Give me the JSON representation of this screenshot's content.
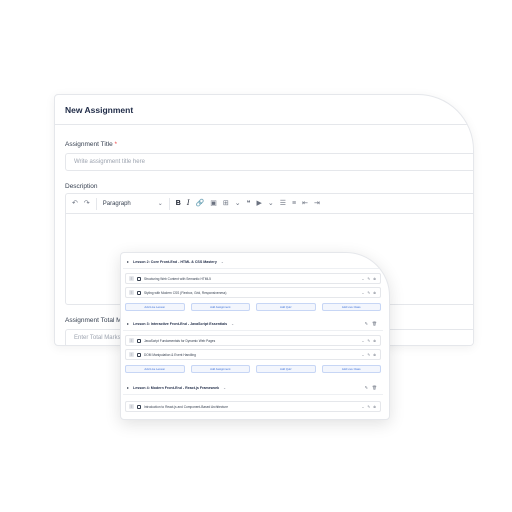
{
  "form": {
    "title": "New Assignment",
    "assignment_title_label": "Assignment Title",
    "required_mark": "*",
    "assignment_title_placeholder": "Write assignment title here",
    "description_label": "Description",
    "toolbar": {
      "undo": "↶",
      "redo": "↷",
      "paragraph": "Paragraph",
      "paragraph_chevron": "⌄",
      "bold": "B",
      "italic": "I",
      "link": "🔗",
      "image": "▣",
      "table": "⊞",
      "table_chevron": "⌄",
      "quote": "❝",
      "media": "▶",
      "media_chevron": "⌄",
      "bulleted_list": "☰",
      "numbered_list": "≡",
      "outdent": "⇤",
      "indent": "⇥"
    },
    "total_marks_label": "Assignment Total Marks",
    "total_marks_placeholder": "Enter Total Marks"
  },
  "curriculum": {
    "lessons": [
      {
        "title": "Lesson 2: Core Front-End - HTML & CSS Mastery",
        "topics": [
          "Structuring Web Content with Semantic HTML5",
          "Styling with Modern CSS (Flexbox, Grid, Responsiveness)"
        ]
      },
      {
        "title": "Lesson 3: Interactive Front-End - JavaScript Essentials",
        "topics": [
          "JavaScript Fundamentals for Dynamic Web Pages",
          "DOM Manipulation & Event Handling"
        ]
      },
      {
        "title": "Lesson 4: Modern Front-End - React.js Framework",
        "topics": [
          "Introduction to React.js and Component-Based Architecture"
        ]
      }
    ],
    "buttons": [
      "Add Live Lesson",
      "Add Assignment",
      "Add Quiz",
      "Add Live Class"
    ],
    "icons": {
      "caret": "▸",
      "title_chevron": "⌄",
      "edit": "✎",
      "delete": "🗑",
      "topic_chevron": "⌄",
      "topic_edit": "✎",
      "topic_delete": "⊗",
      "grip": "⠿"
    }
  }
}
